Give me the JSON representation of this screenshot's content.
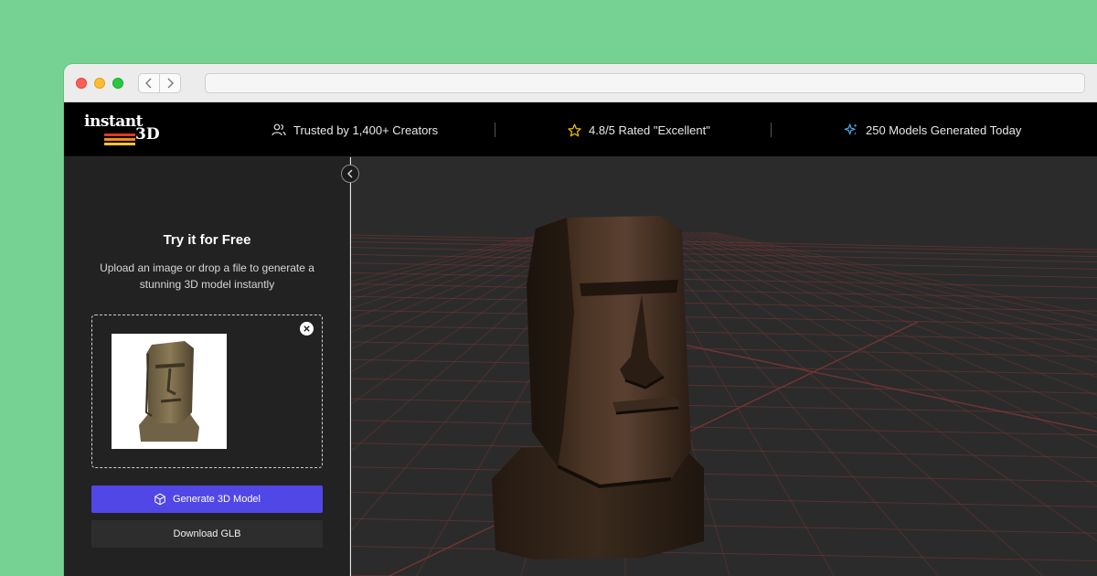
{
  "browser": {
    "back_icon": "chevron-left-icon",
    "forward_icon": "chevron-right-icon",
    "address": ""
  },
  "header": {
    "logo_line1": "instant",
    "logo_line2": "3D",
    "logo_stripe_colors": [
      "#e23a1e",
      "#f08a24",
      "#f4c430"
    ],
    "stats": [
      {
        "icon": "users-icon",
        "text": "Trusted by 1,400+ Creators"
      },
      {
        "icon": "star-icon",
        "text": "4.8/5 Rated \"Excellent\"",
        "icon_color": "#f2c200"
      },
      {
        "icon": "sparkle-icon",
        "text": "250 Models Generated Today",
        "icon_color": "#4ea9e8"
      }
    ]
  },
  "sidebar": {
    "collapse_icon": "chevron-left-icon",
    "title": "Try it for Free",
    "description": "Upload an image or drop a file to generate a stunning 3D model instantly",
    "upload": {
      "remove_icon": "close-icon",
      "preview": "moai-statue-image"
    },
    "generate_label": "Generate 3D Model",
    "generate_icon": "cube-icon",
    "download_label": "Download GLB"
  },
  "viewer": {
    "model": "moai-head-3d-model",
    "grid_line_color": "#7a3636",
    "background": "#2b2b2b"
  },
  "colors": {
    "page_bg": "#76d293",
    "accent": "#5146e6"
  }
}
